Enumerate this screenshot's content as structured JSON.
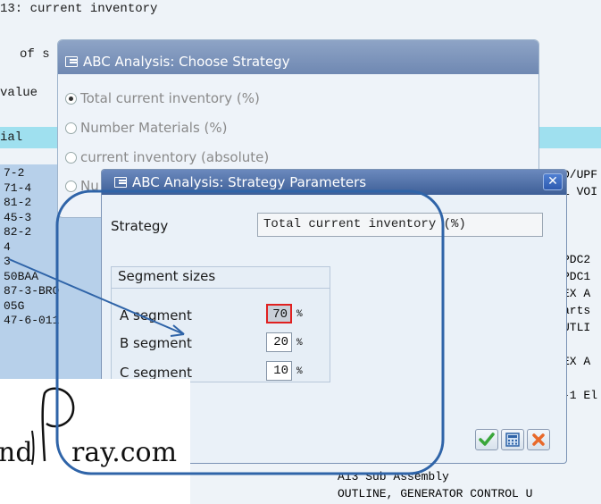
{
  "background": {
    "title_line": "13: current inventory",
    "line_of": "of s",
    "line_value": "value",
    "header_partial": "ial",
    "rows": [
      "7-2",
      "71-4",
      "81-2",
      "45-3",
      "82-2",
      "4",
      "3",
      "50BAA",
      "87-3-BRO",
      "05G",
      "47-6-011"
    ],
    "right_fragments": [
      "D/UPF",
      "1 VOI",
      "",
      "",
      "",
      "PDC2",
      "PDC1",
      "EX A",
      "arts",
      "UTLI",
      "",
      "EX A",
      "",
      "-1 El"
    ],
    "bottom_lines": [
      "A13 Sub Assembly",
      "OUTLINE, GENERATOR CONTROL U"
    ]
  },
  "choose_dialog": {
    "title": "ABC Analysis: Choose Strategy",
    "options": [
      {
        "label": "Total current inventory (%)",
        "selected": true
      },
      {
        "label": "Number Materials (%)",
        "selected": false
      },
      {
        "label": "current inventory (absolute)",
        "selected": false
      },
      {
        "label": "Nu",
        "selected": false
      }
    ]
  },
  "params_dialog": {
    "title": "ABC Analysis: Strategy Parameters",
    "strategy_label": "Strategy",
    "strategy_value": "Total current inventory (%)",
    "segment_sizes_label": "Segment sizes",
    "segments": [
      {
        "label": "A segment",
        "value": "70",
        "unit": "%"
      },
      {
        "label": "B segment",
        "value": "20",
        "unit": "%"
      },
      {
        "label": "C segment",
        "value": "10",
        "unit": "%"
      }
    ],
    "buttons": {
      "confirm_icon": "check-icon",
      "calculator_icon": "calculator-icon",
      "cancel_icon": "cancel-icon"
    }
  },
  "watermark": {
    "text": "nd ray.com"
  },
  "colors": {
    "title_bar": "#3e5f97",
    "highlight_band": "#9fe0ef",
    "annotation": "#2f64a8",
    "confirm_green": "#3aa63a",
    "cancel_orange": "#e8692a"
  }
}
